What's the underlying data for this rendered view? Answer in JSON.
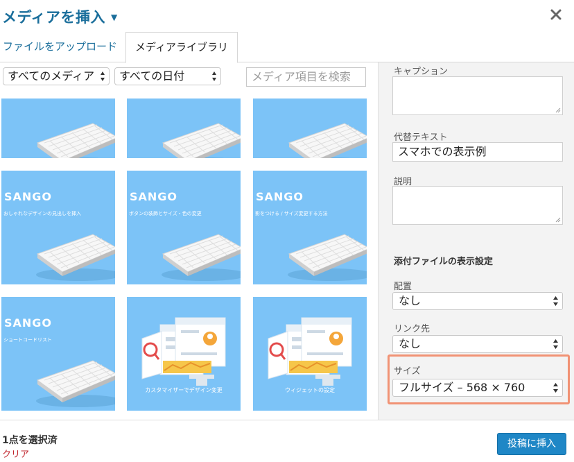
{
  "header": {
    "title": "メディアを挿入",
    "caret": "▼",
    "close": "✕"
  },
  "tabs": [
    {
      "label": "ファイルをアップロード",
      "active": false
    },
    {
      "label": "メディアライブラリ",
      "active": true
    }
  ],
  "filters": {
    "type_value": "すべてのメディア",
    "date_value": "すべての日付",
    "search_placeholder": "メディア項目を検索"
  },
  "grid": {
    "items": [
      {
        "kind": "keyboard"
      },
      {
        "kind": "keyboard"
      },
      {
        "kind": "keyboard"
      },
      {
        "kind": "sango",
        "brand": "SANGO",
        "subtitle": "おしゃれなデザインの見出しを挿入"
      },
      {
        "kind": "sango",
        "brand": "SANGO",
        "subtitle": "ボタンの装飾とサイズ・色の変更"
      },
      {
        "kind": "sango",
        "brand": "SANGO",
        "subtitle": "影をつける / サイズ変更する方法"
      },
      {
        "kind": "sango",
        "brand": "SANGO",
        "subtitle": "ショートコードリスト"
      },
      {
        "kind": "screens",
        "caption": "カスタマイザーでデザイン変更"
      },
      {
        "kind": "screens",
        "caption": "ウィジェットの設定"
      }
    ]
  },
  "sidebar": {
    "caption_label": "キャプション",
    "alt_label": "代替テキスト",
    "alt_value": "スマホでの表示例",
    "description_label": "説明",
    "display_heading": "添付ファイルの表示設定",
    "align_label": "配置",
    "align_value": "なし",
    "link_label": "リンク先",
    "link_value": "なし",
    "size_label": "サイズ",
    "size_value": "フルサイズ – 568 × 760"
  },
  "footer": {
    "selected_count": "1点を選択済",
    "clear": "クリア",
    "insert_button": "投稿に挿入"
  },
  "colors": {
    "accent": "#1a6e9b",
    "thumb_bg": "#7cc3f7",
    "highlight": "#f19274",
    "insert_button": "#1f87c6",
    "clear_link": "#c0262e"
  }
}
